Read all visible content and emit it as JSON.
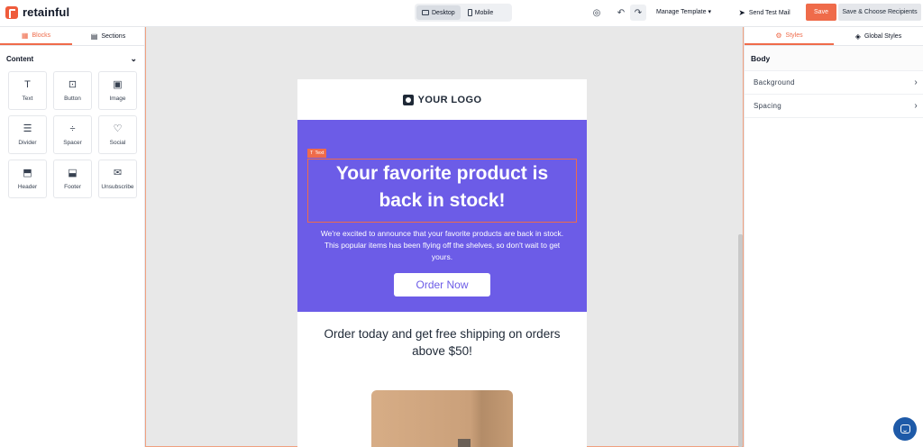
{
  "app": {
    "brand": "retainful"
  },
  "toolbar": {
    "desktop_label": "Desktop",
    "mobile_label": "Mobile",
    "manage_template_label": "Manage Template ▾",
    "send_test_label": "Send Test Mail",
    "save_label": "Save",
    "save_choose_label": "Save & Choose Recipients"
  },
  "left_panel": {
    "tabs": [
      {
        "label": "Blocks",
        "active": true,
        "icon": "grid-icon"
      },
      {
        "label": "Sections",
        "active": false,
        "icon": "sections-icon"
      }
    ],
    "content_heading": "Content",
    "blocks": [
      {
        "label": "Text",
        "icon": "T"
      },
      {
        "label": "Button",
        "icon": "⊡"
      },
      {
        "label": "Image",
        "icon": "▣"
      },
      {
        "label": "Divider",
        "icon": "☰"
      },
      {
        "label": "Spacer",
        "icon": "÷"
      },
      {
        "label": "Social",
        "icon": "♡"
      },
      {
        "label": "Header",
        "icon": "⬒"
      },
      {
        "label": "Footer",
        "icon": "⬓"
      },
      {
        "label": "Unsubscribe",
        "icon": "✉"
      }
    ]
  },
  "email": {
    "logo_text": "YOUR LOGO",
    "selected_tag": "Text",
    "hero_title": "Your favorite product is back in stock!",
    "hero_body": "We're excited to announce that your favorite products are back in stock. This popular items has been flying off the shelves, so don't wait to get yours.",
    "cta_label": "Order Now",
    "shipping_text": "Order today and get free shipping on orders above $50!",
    "hero_color": "#6c5ce7"
  },
  "right_panel": {
    "tabs": [
      {
        "label": "Styles",
        "active": true
      },
      {
        "label": "Global Styles",
        "active": false
      }
    ],
    "section_title": "Body",
    "rows": [
      {
        "label": "Background"
      },
      {
        "label": "Spacing"
      }
    ]
  },
  "colors": {
    "accent": "#ef6b4a",
    "hero": "#6c5ce7",
    "chat": "#1e5aa8"
  }
}
